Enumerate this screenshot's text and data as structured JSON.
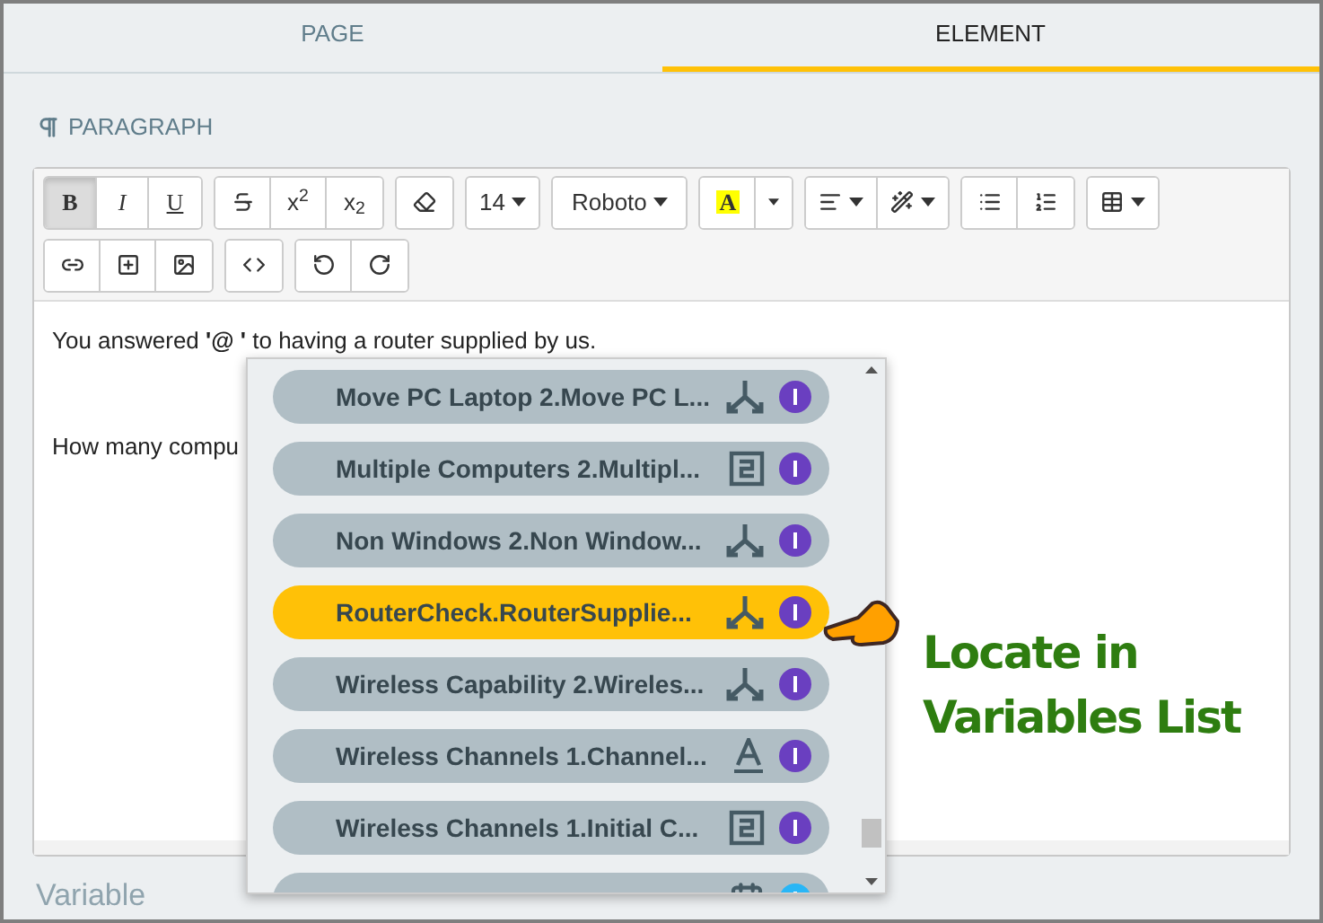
{
  "tabs": [
    {
      "label": "PAGE",
      "selected": false
    },
    {
      "label": "ELEMENT",
      "selected": true
    }
  ],
  "section": {
    "title": "PARAGRAPH"
  },
  "toolbar": {
    "format_buttons": [
      {
        "label": "B",
        "selected": true
      },
      {
        "label": "I",
        "selected": false
      },
      {
        "label": "U",
        "selected": false
      }
    ],
    "script_buttons": [
      "x$^{2}$",
      "x$_{2}$"
    ],
    "font_size": "14",
    "font_name": "Roboto",
    "text_color": "A"
  },
  "editor": {
    "lines": [
      "You answered **'@ '** to having a router supplied by us.",
      "How many compu"
    ]
  },
  "variables": [
    {
      "label": "Move PC Laptop 2.Move PC L...",
      "kind": "branch",
      "selected": false,
      "color": "#6a3fc0"
    },
    {
      "label": "Multiple Computers 2.Multipl...",
      "kind": "number",
      "selected": false,
      "color": "#6a3fc0"
    },
    {
      "label": "Non Windows 2.Non Window...",
      "kind": "branch",
      "selected": false,
      "color": "#6a3fc0"
    },
    {
      "label": "RouterCheck.RouterSupplie...",
      "kind": "branch",
      "selected": true,
      "color": "#6a3fc0"
    },
    {
      "label": "Wireless Capability 2.Wireles...",
      "kind": "branch",
      "selected": false,
      "color": "#6a3fc0"
    },
    {
      "label": "Wireless Channels 1.Channel...",
      "kind": "text",
      "selected": false,
      "color": "#6a3fc0"
    },
    {
      "label": "Wireless Channels 1.Initial C...",
      "kind": "number",
      "selected": false,
      "color": "#6a3fc0"
    },
    {
      "kind": "date",
      "selected": false,
      "color": "#29b6f6"
    }
  ],
  "callout": {
    "text": "Locate in Variables List"
  },
  "next_section": {
    "title": "Variable"
  }
}
